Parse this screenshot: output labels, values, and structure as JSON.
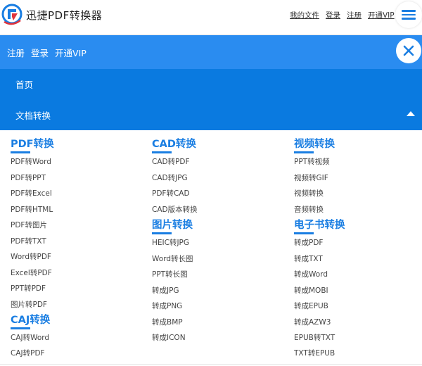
{
  "header": {
    "site_name": "迅捷PDF转换器",
    "links": [
      "我的文件",
      "登录",
      "注册",
      "开通VIP"
    ]
  },
  "blue_bar": {
    "links": [
      "注册",
      "登录",
      "开通VIP"
    ]
  },
  "nav": {
    "home": "首页",
    "docs": "文档转换"
  },
  "sections": {
    "pdf": {
      "title": "PDF转换",
      "items": [
        "PDF转Word",
        "PDF转PPT",
        "PDF转Excel",
        "PDF转HTML",
        "PDF转图片",
        "PDF转TXT",
        "Word转PDF",
        "Excel转PDF",
        "PPT转PDF",
        "图片转PDF"
      ]
    },
    "caj": {
      "title": "CAJ转换",
      "items": [
        "CAJ转Word",
        "CAJ转PDF"
      ]
    },
    "cad": {
      "title": "CAD转换",
      "items": [
        "CAD转PDF",
        "CAD转JPG",
        "PDF转CAD",
        "CAD版本转换"
      ]
    },
    "image": {
      "title": "图片转换",
      "items": [
        "HEIC转JPG",
        "Word转长图",
        "PPT转长图",
        "转成JPG",
        "转成PNG",
        "转成BMP",
        "转成ICON"
      ]
    },
    "video": {
      "title": "视频转换",
      "items": [
        "PPT转视频",
        "视频转GIF",
        "视频转换",
        "音频转换"
      ]
    },
    "ebook": {
      "title": "电子书转换",
      "items": [
        "转成PDF",
        "转成TXT",
        "转成Word",
        "转成MOBI",
        "转成EPUB",
        "转成AZW3",
        "EPUB转TXT",
        "TXT转EPUB"
      ]
    }
  },
  "colors": {
    "accent": "#1a7ee2",
    "blue_bar": "#2a8cf0",
    "nav_panel": "#0a7ae0"
  },
  "icons": {
    "logo": "logo-icon",
    "menu": "hamburger-menu-icon",
    "close": "close-icon",
    "collapse": "caret-up-icon"
  }
}
